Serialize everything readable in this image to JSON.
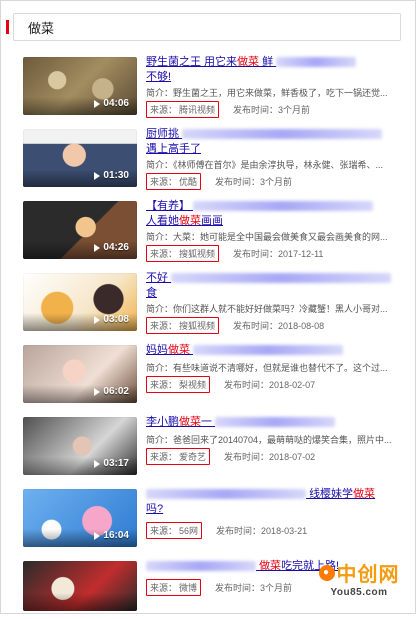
{
  "search": {
    "query": "做菜"
  },
  "items": [
    {
      "title_a": "野生菌之王 用它来",
      "title_hl": "做菜",
      "title_b": " 鲜",
      "title2": "不够!",
      "summary": "简介：野生菌之王，用它来做菜，鲜香极了，吃下一锅还觉...",
      "source_label": "来源：",
      "source_value": "腾讯视频",
      "time_label": "发布时间：",
      "time_value": "3个月前",
      "duration": "04:06",
      "icon": "play-icon",
      "thumb_colors": [
        "#7b6a47",
        "#c2b28a",
        "#5e4f36"
      ]
    },
    {
      "title_a": "厨师挑",
      "title_hl": "",
      "title_b": "",
      "title2": "遇上高手了",
      "summary": "简介：《林师傅在首尔》是由余淳执导，林永健、张瑞希、...",
      "source_label": "来源：",
      "source_value": "优酷",
      "time_label": "发布时间：",
      "time_value": "3个月前",
      "duration": "01:30",
      "icon": "play-icon",
      "thumb_colors": [
        "#d9d9d9",
        "#3b4b6a",
        "#b87f5d"
      ]
    },
    {
      "title_a": "【有养】",
      "title_hl": "",
      "title_b": "",
      "title2_a": "人看她",
      "title2_hl": "做菜",
      "title2_b": "画画",
      "summary": "简介：大菜：她可能是全中国最会做美食又最会画美食的网...",
      "source_label": "来源：",
      "source_value": "搜狐视频",
      "time_label": "发布时间：",
      "time_value": "2017-12-11",
      "duration": "04:26",
      "icon": "play-icon",
      "thumb_colors": [
        "#3a3a3a",
        "#f2c37a",
        "#8a5a3c"
      ]
    },
    {
      "title_a": "不好",
      "title_hl": "",
      "title_b": "",
      "title2": "食",
      "summary": "简介：你们这群人就不能好好做菜吗？冷藏蟹！黑人小哥对...",
      "source_label": "来源：",
      "source_value": "搜狐视频",
      "time_label": "发布时间：",
      "time_value": "2018-08-08",
      "duration": "03:08",
      "icon": "play-icon",
      "thumb_colors": [
        "#f1b24a",
        "#ffffff",
        "#3b2a2a"
      ]
    },
    {
      "title_a": "妈妈",
      "title_hl": "做菜",
      "title_b": "",
      "title2": "",
      "summary": "简介：有些味道说不清哪好，但就是谁也替代不了。这个过...",
      "source_label": "来源：",
      "source_value": "梨视频",
      "time_label": "发布时间：",
      "time_value": "2018-02-07",
      "duration": "06:02",
      "icon": "play-icon",
      "thumb_colors": [
        "#b8a49a",
        "#f0dfd4",
        "#6b4d3a"
      ]
    },
    {
      "title_a": "李小鹏",
      "title_hl": "做菜",
      "title_b": "一",
      "title2": "",
      "summary": "简介：爸爸回来了20140704，最萌萌哒的爆笑合集，照片中...",
      "source_label": "来源：",
      "source_value": "爱奇艺",
      "time_label": "发布时间：",
      "time_value": "2018-07-02",
      "duration": "03:17",
      "icon": "play-icon",
      "thumb_colors": [
        "#5c5c5c",
        "#d6d6d6",
        "#2f2f2f"
      ]
    },
    {
      "title_a": "",
      "title_hl": "",
      "title_b": "线樱妹学",
      "title_tail_hl": "做菜",
      "title2": "吗?",
      "summary": "",
      "source_label": "来源：",
      "source_value": "56网",
      "time_label": "发布时间：",
      "time_value": "2018-03-21",
      "duration": "16:04",
      "icon": "play-icon",
      "thumb_colors": [
        "#6fb1f0",
        "#f6a6c9",
        "#2e7bd2"
      ]
    },
    {
      "title_a": "",
      "title_hl": "做菜",
      "title_b": "吃完就上路!",
      "title2": "",
      "summary": "",
      "source_label": "来源：",
      "source_value": "微博",
      "time_label": "发布时间：",
      "time_value": "3个月前",
      "duration": "",
      "icon": "play-icon",
      "thumb_colors": [
        "#2b2b2b",
        "#c12d2d",
        "#f2e9d8"
      ]
    }
  ],
  "watermark": {
    "brand": "中创网",
    "site": "You85.com",
    "colors": {
      "orange": "#ff7a00",
      "gold": "#f39c12"
    }
  }
}
